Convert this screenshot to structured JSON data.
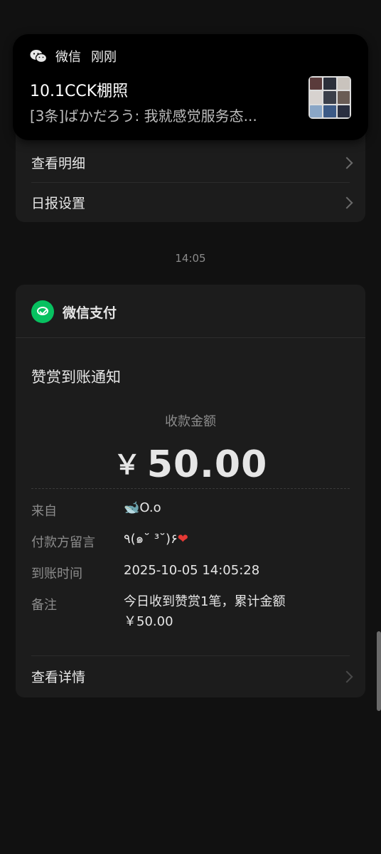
{
  "top_card": {
    "rows": [
      {
        "label": "查看明细"
      },
      {
        "label": "日报设置"
      }
    ]
  },
  "notification": {
    "app": "微信",
    "time": "刚刚",
    "title": "10.1CCK棚照",
    "preview": "[3条]ばかだろう: 我就感觉服务态..."
  },
  "timestamp": "14:05",
  "pay_card": {
    "brand": "微信支付",
    "notice_title": "赞赏到账通知",
    "amount_label": "收款金额",
    "currency": "￥",
    "amount": "50.00",
    "fields": [
      {
        "key": "来自",
        "value": "🐋O.o"
      },
      {
        "key": "付款方留言",
        "value": "٩(๑˘ ³˘)۶",
        "value_suffix": "❤"
      },
      {
        "key": "到账时间",
        "value": "2025-10-05 14:05:28"
      },
      {
        "key": "备注",
        "value": "今日收到赞赏1笔，累计金额",
        "value_line2": "￥50.00"
      }
    ],
    "details_link": "查看详情"
  },
  "colors": {
    "background": "#111111",
    "card": "#1c1c1c",
    "wechat_green": "#07c160",
    "heart": "#e53935"
  }
}
